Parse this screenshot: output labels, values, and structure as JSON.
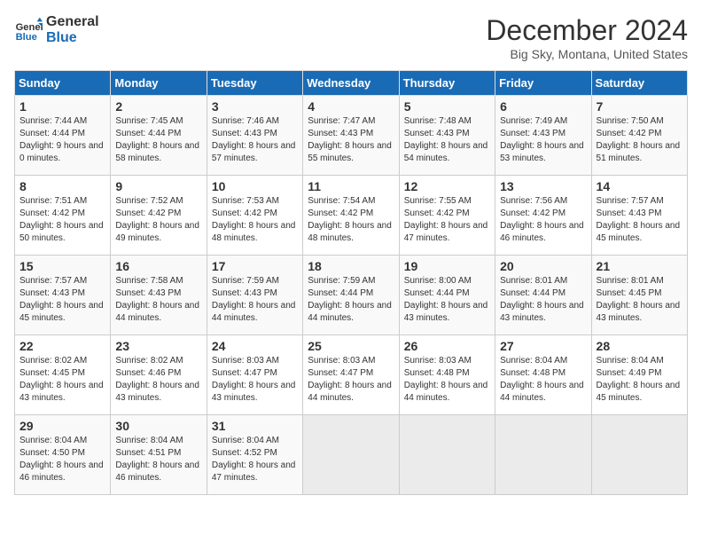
{
  "header": {
    "logo_line1": "General",
    "logo_line2": "Blue",
    "title": "December 2024",
    "subtitle": "Big Sky, Montana, United States"
  },
  "weekdays": [
    "Sunday",
    "Monday",
    "Tuesday",
    "Wednesday",
    "Thursday",
    "Friday",
    "Saturday"
  ],
  "weeks": [
    [
      {
        "day": 1,
        "sunrise": "Sunrise: 7:44 AM",
        "sunset": "Sunset: 4:44 PM",
        "daylight": "Daylight: 9 hours and 0 minutes."
      },
      {
        "day": 2,
        "sunrise": "Sunrise: 7:45 AM",
        "sunset": "Sunset: 4:44 PM",
        "daylight": "Daylight: 8 hours and 58 minutes."
      },
      {
        "day": 3,
        "sunrise": "Sunrise: 7:46 AM",
        "sunset": "Sunset: 4:43 PM",
        "daylight": "Daylight: 8 hours and 57 minutes."
      },
      {
        "day": 4,
        "sunrise": "Sunrise: 7:47 AM",
        "sunset": "Sunset: 4:43 PM",
        "daylight": "Daylight: 8 hours and 55 minutes."
      },
      {
        "day": 5,
        "sunrise": "Sunrise: 7:48 AM",
        "sunset": "Sunset: 4:43 PM",
        "daylight": "Daylight: 8 hours and 54 minutes."
      },
      {
        "day": 6,
        "sunrise": "Sunrise: 7:49 AM",
        "sunset": "Sunset: 4:43 PM",
        "daylight": "Daylight: 8 hours and 53 minutes."
      },
      {
        "day": 7,
        "sunrise": "Sunrise: 7:50 AM",
        "sunset": "Sunset: 4:42 PM",
        "daylight": "Daylight: 8 hours and 51 minutes."
      }
    ],
    [
      {
        "day": 8,
        "sunrise": "Sunrise: 7:51 AM",
        "sunset": "Sunset: 4:42 PM",
        "daylight": "Daylight: 8 hours and 50 minutes."
      },
      {
        "day": 9,
        "sunrise": "Sunrise: 7:52 AM",
        "sunset": "Sunset: 4:42 PM",
        "daylight": "Daylight: 8 hours and 49 minutes."
      },
      {
        "day": 10,
        "sunrise": "Sunrise: 7:53 AM",
        "sunset": "Sunset: 4:42 PM",
        "daylight": "Daylight: 8 hours and 48 minutes."
      },
      {
        "day": 11,
        "sunrise": "Sunrise: 7:54 AM",
        "sunset": "Sunset: 4:42 PM",
        "daylight": "Daylight: 8 hours and 48 minutes."
      },
      {
        "day": 12,
        "sunrise": "Sunrise: 7:55 AM",
        "sunset": "Sunset: 4:42 PM",
        "daylight": "Daylight: 8 hours and 47 minutes."
      },
      {
        "day": 13,
        "sunrise": "Sunrise: 7:56 AM",
        "sunset": "Sunset: 4:42 PM",
        "daylight": "Daylight: 8 hours and 46 minutes."
      },
      {
        "day": 14,
        "sunrise": "Sunrise: 7:57 AM",
        "sunset": "Sunset: 4:43 PM",
        "daylight": "Daylight: 8 hours and 45 minutes."
      }
    ],
    [
      {
        "day": 15,
        "sunrise": "Sunrise: 7:57 AM",
        "sunset": "Sunset: 4:43 PM",
        "daylight": "Daylight: 8 hours and 45 minutes."
      },
      {
        "day": 16,
        "sunrise": "Sunrise: 7:58 AM",
        "sunset": "Sunset: 4:43 PM",
        "daylight": "Daylight: 8 hours and 44 minutes."
      },
      {
        "day": 17,
        "sunrise": "Sunrise: 7:59 AM",
        "sunset": "Sunset: 4:43 PM",
        "daylight": "Daylight: 8 hours and 44 minutes."
      },
      {
        "day": 18,
        "sunrise": "Sunrise: 7:59 AM",
        "sunset": "Sunset: 4:44 PM",
        "daylight": "Daylight: 8 hours and 44 minutes."
      },
      {
        "day": 19,
        "sunrise": "Sunrise: 8:00 AM",
        "sunset": "Sunset: 4:44 PM",
        "daylight": "Daylight: 8 hours and 43 minutes."
      },
      {
        "day": 20,
        "sunrise": "Sunrise: 8:01 AM",
        "sunset": "Sunset: 4:44 PM",
        "daylight": "Daylight: 8 hours and 43 minutes."
      },
      {
        "day": 21,
        "sunrise": "Sunrise: 8:01 AM",
        "sunset": "Sunset: 4:45 PM",
        "daylight": "Daylight: 8 hours and 43 minutes."
      }
    ],
    [
      {
        "day": 22,
        "sunrise": "Sunrise: 8:02 AM",
        "sunset": "Sunset: 4:45 PM",
        "daylight": "Daylight: 8 hours and 43 minutes."
      },
      {
        "day": 23,
        "sunrise": "Sunrise: 8:02 AM",
        "sunset": "Sunset: 4:46 PM",
        "daylight": "Daylight: 8 hours and 43 minutes."
      },
      {
        "day": 24,
        "sunrise": "Sunrise: 8:03 AM",
        "sunset": "Sunset: 4:47 PM",
        "daylight": "Daylight: 8 hours and 43 minutes."
      },
      {
        "day": 25,
        "sunrise": "Sunrise: 8:03 AM",
        "sunset": "Sunset: 4:47 PM",
        "daylight": "Daylight: 8 hours and 44 minutes."
      },
      {
        "day": 26,
        "sunrise": "Sunrise: 8:03 AM",
        "sunset": "Sunset: 4:48 PM",
        "daylight": "Daylight: 8 hours and 44 minutes."
      },
      {
        "day": 27,
        "sunrise": "Sunrise: 8:04 AM",
        "sunset": "Sunset: 4:48 PM",
        "daylight": "Daylight: 8 hours and 44 minutes."
      },
      {
        "day": 28,
        "sunrise": "Sunrise: 8:04 AM",
        "sunset": "Sunset: 4:49 PM",
        "daylight": "Daylight: 8 hours and 45 minutes."
      }
    ],
    [
      {
        "day": 29,
        "sunrise": "Sunrise: 8:04 AM",
        "sunset": "Sunset: 4:50 PM",
        "daylight": "Daylight: 8 hours and 46 minutes."
      },
      {
        "day": 30,
        "sunrise": "Sunrise: 8:04 AM",
        "sunset": "Sunset: 4:51 PM",
        "daylight": "Daylight: 8 hours and 46 minutes."
      },
      {
        "day": 31,
        "sunrise": "Sunrise: 8:04 AM",
        "sunset": "Sunset: 4:52 PM",
        "daylight": "Daylight: 8 hours and 47 minutes."
      },
      null,
      null,
      null,
      null
    ]
  ]
}
